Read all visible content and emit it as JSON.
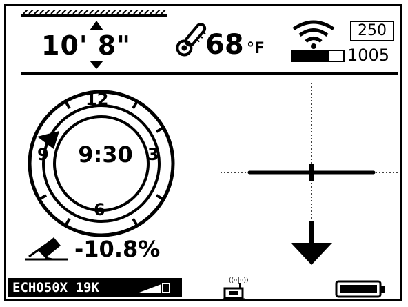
{
  "depth": {
    "display": "10' 8\""
  },
  "temperature": {
    "value": "68",
    "unit": "°F"
  },
  "signal": {
    "top_value": "250",
    "bottom_value": "1005"
  },
  "clock": {
    "time": "9:30",
    "labels": {
      "twelve": "12",
      "three": "3",
      "six": "6",
      "nine": "9"
    }
  },
  "roll": {
    "value": "-10.8%"
  },
  "status": {
    "device": "ECHO50X 19K"
  },
  "icons": {
    "thermometer": "thermometer-icon",
    "wifi": "wifi-icon",
    "battery": "battery-icon",
    "locator": "locator-icon",
    "pitch": "pitch-icon",
    "signal_bars": "signal-bars-icon"
  }
}
